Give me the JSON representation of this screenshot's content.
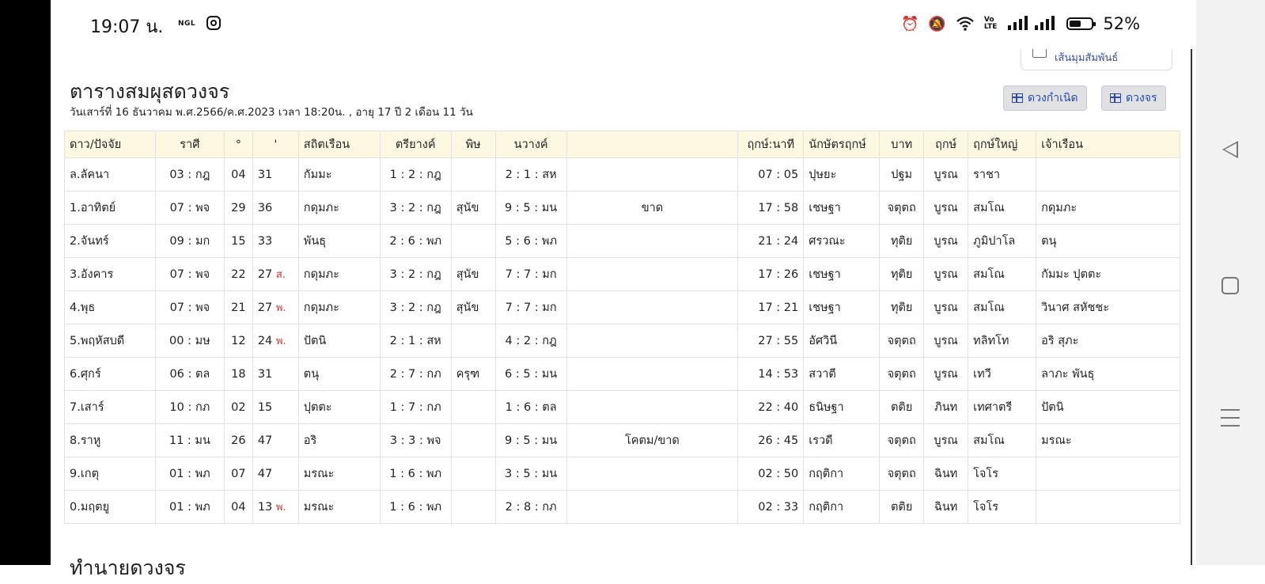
{
  "status_bar": {
    "time": "19:07 น.",
    "carrier_badge": "NGL",
    "battery": "52%",
    "icons": [
      "instagram-icon",
      "alarm-icon",
      "mute-icon",
      "wifi-icon",
      "volte-icon",
      "signal-icon",
      "battery-icon"
    ]
  },
  "option_checkbox": {
    "label": "เส้นมุมสัมพันธ์",
    "checked": false
  },
  "header": {
    "title": "ตารางสมผุสดวงจร",
    "subtitle": "วันเสาร์ที่ 16 ธันวาคม พ.ศ.2566/ค.ศ.2023 เวลา 18:20น. , อายุ 17 ปี 2 เดือน 11 วัน"
  },
  "buttons": {
    "natal": "ดวงกำเนิด",
    "transit": "ดวงจร"
  },
  "table": {
    "columns": [
      "ดาว/ปัจจัย",
      "ราศี",
      "°",
      "'",
      "สถิตเรือน",
      "ตรียางค์",
      "พิษ",
      "นวางค์",
      "",
      "ฤกษ์:นาที",
      "นักษัตรฤกษ์",
      "บาท",
      "ฤกษ์",
      "ฤกษ์ใหญ่",
      "เจ้าเรือน"
    ],
    "rows": [
      {
        "planet": "ล.ลัคนา",
        "rasi": "03 : กฎ",
        "deg": "04",
        "min": "31",
        "flag": "",
        "house": "กัมมะ",
        "tri": "1 : 2 : กฎ",
        "pit": "",
        "nav": "2 : 1 : สห",
        "note": "",
        "rm": "07 : 05",
        "nak": "ปุษยะ",
        "bat": "ปฐม",
        "rk": "บูรณ",
        "ry": "ราชา",
        "owner": ""
      },
      {
        "planet": "1.อาทิตย์",
        "rasi": "07 : พจ",
        "deg": "29",
        "min": "36",
        "flag": "",
        "house": "กดุมภะ",
        "tri": "3 : 2 : กฎ",
        "pit": "สุนัข",
        "nav": "9 : 5 : มน",
        "note": "ขาด",
        "rm": "17 : 58",
        "nak": "เชษฐา",
        "bat": "จตุตถ",
        "rk": "บูรณ",
        "ry": "สมโณ",
        "owner": "กดุมภะ"
      },
      {
        "planet": "2.จันทร์",
        "rasi": "09 : มก",
        "deg": "15",
        "min": "33",
        "flag": "",
        "house": "พันธุ",
        "tri": "2 : 6 : พภ",
        "pit": "",
        "nav": "5 : 6 : พภ",
        "note": "",
        "rm": "21 : 24",
        "nak": "ศรวณะ",
        "bat": "ทุติย",
        "rk": "บูรณ",
        "ry": "ภูมิปาโล",
        "owner": "ตนุ"
      },
      {
        "planet": "3.อังคาร",
        "rasi": "07 : พจ",
        "deg": "22",
        "min": "27",
        "flag": "ส.",
        "house": "กดุมภะ",
        "tri": "3 : 2 : กฎ",
        "pit": "สุนัข",
        "nav": "7 : 7 : มก",
        "note": "",
        "rm": "17 : 26",
        "nak": "เชษฐา",
        "bat": "ทุติย",
        "rk": "บูรณ",
        "ry": "สมโณ",
        "owner": "กัมมะ ปุตตะ"
      },
      {
        "planet": "4.พุธ",
        "rasi": "07 : พจ",
        "deg": "21",
        "min": "27",
        "flag": "พ.",
        "house": "กดุมภะ",
        "tri": "3 : 2 : กฎ",
        "pit": "สุนัข",
        "nav": "7 : 7 : มก",
        "note": "",
        "rm": "17 : 21",
        "nak": "เชษฐา",
        "bat": "ทุติย",
        "rk": "บูรณ",
        "ry": "สมโณ",
        "owner": "วินาศ สหัชชะ"
      },
      {
        "planet": "5.พฤหัสบดี",
        "rasi": "00 : มษ",
        "deg": "12",
        "min": "24",
        "flag": "พ.",
        "house": "ปัตนิ",
        "tri": "2 : 1 : สห",
        "pit": "",
        "nav": "4 : 2 : กฎ",
        "note": "",
        "rm": "27 : 55",
        "nak": "อัศวินี",
        "bat": "จตุตถ",
        "rk": "บูรณ",
        "ry": "ทลิทโท",
        "owner": "อริ สุภะ"
      },
      {
        "planet": "6.ศุกร์",
        "rasi": "06 : ตล",
        "deg": "18",
        "min": "31",
        "flag": "",
        "house": "ตนุ",
        "tri": "2 : 7 : กภ",
        "pit": "ครุฑ",
        "nav": "6 : 5 : มน",
        "note": "",
        "rm": "14 : 53",
        "nak": "สวาตี",
        "bat": "จตุตถ",
        "rk": "บูรณ",
        "ry": "เทวี",
        "owner": "ลาภะ พันธุ"
      },
      {
        "planet": "7.เสาร์",
        "rasi": "10 : กภ",
        "deg": "02",
        "min": "15",
        "flag": "",
        "house": "ปุตตะ",
        "tri": "1 : 7 : กภ",
        "pit": "",
        "nav": "1 : 6 : ตล",
        "note": "",
        "rm": "22 : 40",
        "nak": "ธนิษฐา",
        "bat": "ตติย",
        "rk": "ภินท",
        "ry": "เทศาตรี",
        "owner": "ปัตนิ"
      },
      {
        "planet": "8.ราหู",
        "rasi": "11 : มน",
        "deg": "26",
        "min": "47",
        "flag": "",
        "house": "อริ",
        "tri": "3 : 3 : พจ",
        "pit": "",
        "nav": "9 : 5 : มน",
        "note": "โคตม/ขาด",
        "rm": "26 : 45",
        "nak": "เรวดี",
        "bat": "จตุตถ",
        "rk": "บูรณ",
        "ry": "สมโณ",
        "owner": "มรณะ"
      },
      {
        "planet": "9.เกตุ",
        "rasi": "01 : พภ",
        "deg": "07",
        "min": "47",
        "flag": "",
        "house": "มรณะ",
        "tri": "1 : 6 : พภ",
        "pit": "",
        "nav": "3 : 5 : มน",
        "note": "",
        "rm": "02 : 50",
        "nak": "กฤติกา",
        "bat": "จตุตถ",
        "rk": "ฉินท",
        "ry": "โจโร",
        "owner": ""
      },
      {
        "planet": "0.มฤตยู",
        "rasi": "01 : พภ",
        "deg": "04",
        "min": "13",
        "flag": "พ.",
        "house": "มรณะ",
        "tri": "1 : 6 : พภ",
        "pit": "",
        "nav": "2 : 8 : กภ",
        "note": "",
        "rm": "02 : 33",
        "nak": "กฤติกา",
        "bat": "ตติย",
        "rk": "ฉินท",
        "ry": "โจโร",
        "owner": ""
      }
    ]
  },
  "next_section_title": "ทำนายดวงจร"
}
